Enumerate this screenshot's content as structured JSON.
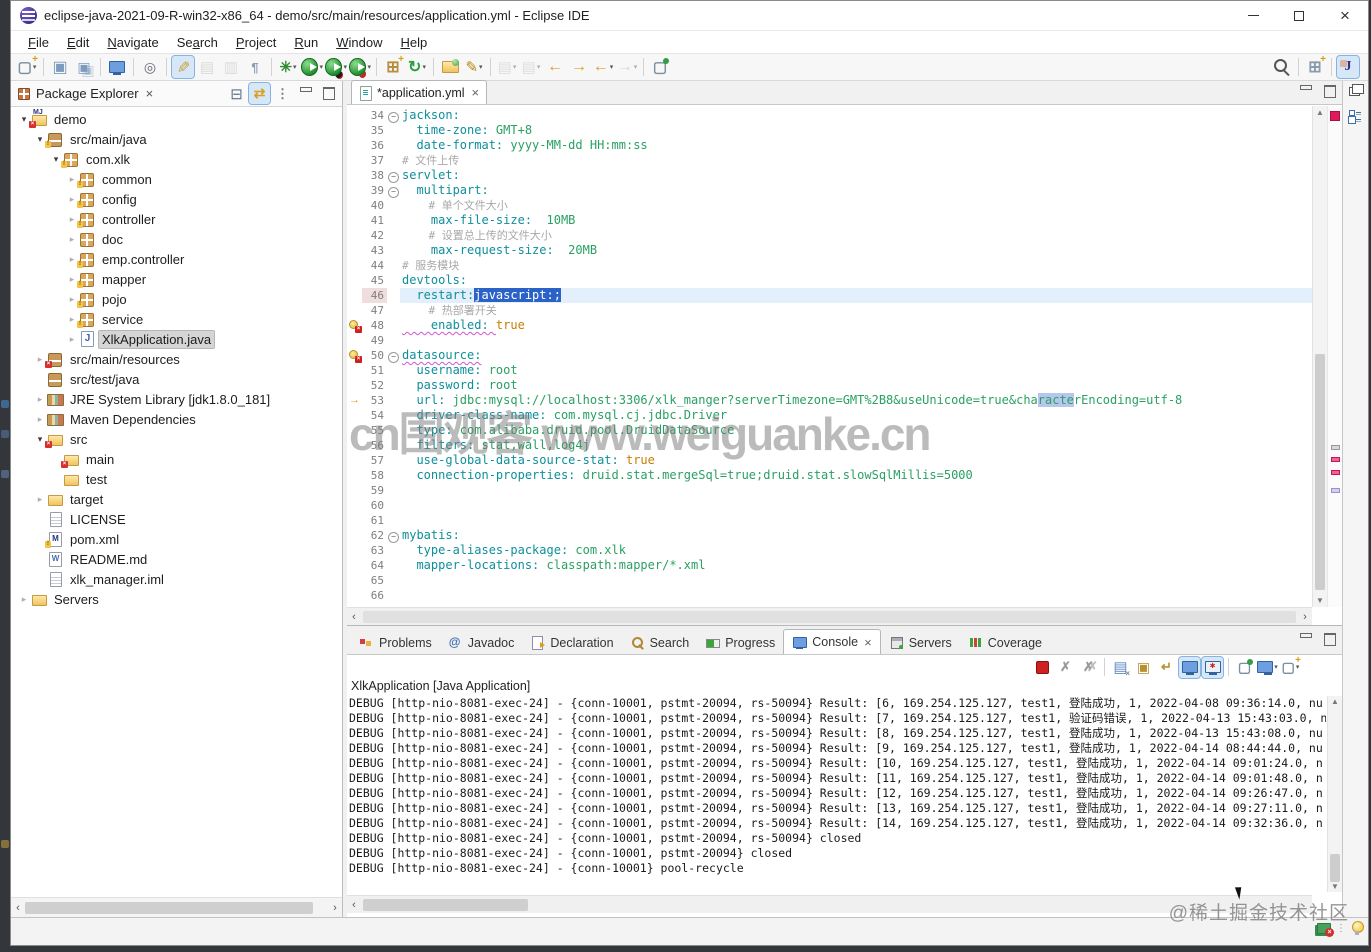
{
  "window": {
    "title": "eclipse-java-2021-09-R-win32-x86_64 - demo/src/main/resources/application.yml - Eclipse IDE"
  },
  "menubar": {
    "items": [
      {
        "label": "File",
        "m": 0
      },
      {
        "label": "Edit",
        "m": 0
      },
      {
        "label": "Navigate",
        "m": 0
      },
      {
        "label": "Search",
        "m": 2
      },
      {
        "label": "Project",
        "m": 0
      },
      {
        "label": "Run",
        "m": 0
      },
      {
        "label": "Window",
        "m": 0
      },
      {
        "label": "Help",
        "m": 0
      }
    ]
  },
  "toolbar": {
    "items": [
      {
        "n": "new-wizard",
        "i": "t-new",
        "dd": true
      },
      {
        "sep": true
      },
      {
        "n": "save",
        "i": "t-save"
      },
      {
        "n": "save-all",
        "i": "t-saveall"
      },
      {
        "sep": true
      },
      {
        "n": "open-console-view",
        "i": "t-monitor"
      },
      {
        "sep": true
      },
      {
        "n": "inspect",
        "i": "t-inspect"
      },
      {
        "sep": true
      },
      {
        "n": "toggle-highlight",
        "i": "t-highlight",
        "active": true
      },
      {
        "n": "copy-qualified-name",
        "i": "t-copyq",
        "dis": true
      },
      {
        "n": "open-element",
        "i": "t-openel",
        "dis": true
      },
      {
        "n": "show-whitespace",
        "i": "t-para"
      },
      {
        "sep": true
      },
      {
        "n": "debug",
        "i": "t-debug",
        "dd": true
      },
      {
        "n": "run",
        "i": "t-run",
        "dd": true
      },
      {
        "n": "coverage",
        "i": "t-coverage",
        "dd": true
      },
      {
        "n": "profile",
        "i": "t-profile",
        "dd": true
      },
      {
        "sep": true
      },
      {
        "n": "new-java-package",
        "i": "t-newpkg"
      },
      {
        "n": "run-external-tools",
        "i": "t-refresh",
        "dd": true
      },
      {
        "sep": true
      },
      {
        "n": "open-resource",
        "i": "t-openres"
      },
      {
        "n": "annotate",
        "i": "t-pen",
        "dd": true
      },
      {
        "sep": true
      },
      {
        "n": "next-annotation",
        "i": "t-nexta",
        "dd": true,
        "dis": true
      },
      {
        "n": "previous-annotation",
        "i": "t-preva",
        "dd": true,
        "dis": true
      },
      {
        "n": "last-edit-location",
        "i": "t-backstar"
      },
      {
        "n": "next-edit-location",
        "i": "t-fwdstar"
      },
      {
        "n": "back-history",
        "i": "t-back",
        "dd": true
      },
      {
        "n": "forward-history",
        "i": "t-fwd",
        "dd": true,
        "dis": true
      },
      {
        "sep": true
      },
      {
        "n": "pin-editor",
        "i": "t-pinedit"
      }
    ],
    "right_items": [
      {
        "n": "search",
        "i": "t-search"
      },
      {
        "sep": true
      },
      {
        "n": "open-perspective",
        "i": "t-persp"
      },
      {
        "sep": true
      },
      {
        "n": "java-perspective",
        "i": "t-javapersp",
        "active": true
      }
    ]
  },
  "package_explorer": {
    "title": "Package Explorer",
    "tools": [
      {
        "n": "collapse-all",
        "i": "p-collapse"
      },
      {
        "n": "link-with-editor",
        "i": "p-link",
        "active": true
      },
      {
        "n": "view-menu",
        "i": "p-menu"
      },
      {
        "n": "minimize-view",
        "i": "p-min"
      },
      {
        "n": "maximize-view",
        "i": "p-max"
      }
    ],
    "tree": [
      {
        "label": "demo",
        "level": 0,
        "arrow": "v",
        "icon": "mvnicon dec-err"
      },
      {
        "label": "src/main/java",
        "level": 1,
        "arrow": "v",
        "icon": "srcicon dec-warn"
      },
      {
        "label": "com.xlk",
        "level": 2,
        "arrow": "v",
        "icon": "pkgicon dec-warn"
      },
      {
        "label": "common",
        "level": 3,
        "arrow": "c",
        "icon": "pkgicon dec-warn"
      },
      {
        "label": "config",
        "level": 3,
        "arrow": "c",
        "icon": "pkgicon dec-warn"
      },
      {
        "label": "controller",
        "level": 3,
        "arrow": "c",
        "icon": "pkgicon dec-warn"
      },
      {
        "label": "doc",
        "level": 3,
        "arrow": "c",
        "icon": "pkgicon"
      },
      {
        "label": "emp.controller",
        "level": 3,
        "arrow": "c",
        "icon": "pkgicon dec-warn"
      },
      {
        "label": "mapper",
        "level": 3,
        "arrow": "c",
        "icon": "pkgicon dec-warn"
      },
      {
        "label": "pojo",
        "level": 3,
        "arrow": "c",
        "icon": "pkgicon dec-warn"
      },
      {
        "label": "service",
        "level": 3,
        "arrow": "c",
        "icon": "pkgicon dec-warn"
      },
      {
        "label": "XlkApplication.java",
        "level": 3,
        "arrow": "c",
        "icon": "javaicon",
        "selected": true
      },
      {
        "label": "src/main/resources",
        "level": 1,
        "arrow": "c",
        "icon": "srcicon dec-err"
      },
      {
        "label": "src/test/java",
        "level": 1,
        "arrow": "",
        "icon": "srcicon"
      },
      {
        "label": "JRE System Library [jdk1.8.0_181]",
        "level": 1,
        "arrow": "c",
        "icon": "libicon"
      },
      {
        "label": "Maven Dependencies",
        "level": 1,
        "arrow": "c",
        "icon": "libicon"
      },
      {
        "label": "src",
        "level": 1,
        "arrow": "v",
        "icon": "foldericon dec-err"
      },
      {
        "label": "main",
        "level": 2,
        "arrow": "",
        "icon": "foldericon dec-err"
      },
      {
        "label": "test",
        "level": 2,
        "arrow": "",
        "icon": "foldericon"
      },
      {
        "label": "target",
        "level": 1,
        "arrow": "c",
        "icon": "foldericon"
      },
      {
        "label": "LICENSE",
        "level": 1,
        "arrow": "",
        "icon": "fileicon"
      },
      {
        "label": "pom.xml",
        "level": 1,
        "arrow": "",
        "icon": "pomicon dec-warn"
      },
      {
        "label": "README.md",
        "level": 1,
        "arrow": "",
        "icon": "mdicon"
      },
      {
        "label": "xlk_manager.iml",
        "level": 1,
        "arrow": "",
        "icon": "fileicon"
      },
      {
        "label": "Servers",
        "level": 0,
        "arrow": "c",
        "icon": "foldericon"
      }
    ]
  },
  "editor": {
    "tab_label": "*application.yml",
    "watermark": "cn围观客 www.weiguanke.cn",
    "lines": [
      {
        "n": 34,
        "fold": true,
        "seg": [
          [
            "k",
            "jackson:"
          ]
        ]
      },
      {
        "n": 35,
        "seg": [
          [
            "k",
            "  time-zone: "
          ],
          [
            "v",
            "GMT+8"
          ]
        ]
      },
      {
        "n": 36,
        "seg": [
          [
            "k",
            "  date-format: "
          ],
          [
            "v",
            "yyyy-MM-dd HH:mm:ss"
          ]
        ]
      },
      {
        "n": 37,
        "seg": [
          [
            "c",
            "# 文件上传"
          ]
        ]
      },
      {
        "n": 38,
        "fold": true,
        "seg": [
          [
            "k",
            "servlet:"
          ]
        ]
      },
      {
        "n": 39,
        "fold": true,
        "seg": [
          [
            "k",
            "  multipart:"
          ]
        ]
      },
      {
        "n": 40,
        "seg": [
          [
            "c",
            "    # 单个文件大小"
          ]
        ]
      },
      {
        "n": 41,
        "seg": [
          [
            "k",
            "    max-file-size:  "
          ],
          [
            "v",
            "10MB"
          ]
        ]
      },
      {
        "n": 42,
        "seg": [
          [
            "c",
            "    # 设置总上传的文件大小"
          ]
        ]
      },
      {
        "n": 43,
        "seg": [
          [
            "k",
            "    max-request-size:  "
          ],
          [
            "v",
            "20MB"
          ]
        ]
      },
      {
        "n": 44,
        "seg": [
          [
            "c",
            "# 服务模块"
          ]
        ]
      },
      {
        "n": 45,
        "seg": [
          [
            "k",
            "devtools:"
          ]
        ]
      },
      {
        "n": 46,
        "cur": true,
        "numhl": true,
        "seg": [
          [
            "k",
            "  restart:"
          ],
          [
            "s",
            "javascript:;"
          ]
        ]
      },
      {
        "n": 47,
        "seg": [
          [
            "c",
            "    # 热部署开关"
          ]
        ]
      },
      {
        "n": 48,
        "err": true,
        "seg": [
          [
            "w",
            "    enabled: "
          ],
          [
            "b",
            "true"
          ]
        ]
      },
      {
        "n": 49,
        "seg": []
      },
      {
        "n": 50,
        "fold": true,
        "err": true,
        "seg": [
          [
            "w",
            "datasource:"
          ]
        ]
      },
      {
        "n": 51,
        "seg": [
          [
            "k",
            "  username: "
          ],
          [
            "v",
            "root"
          ]
        ]
      },
      {
        "n": 52,
        "seg": [
          [
            "k",
            "  password: "
          ],
          [
            "v",
            "root"
          ]
        ]
      },
      {
        "n": 53,
        "arrow": true,
        "seg": [
          [
            "k",
            "  url: "
          ],
          [
            "v",
            "jdbc:mysql://localhost:3306/xlk_manger?serverTimezone=GMT%2B8&useUnicode=true&cha"
          ],
          [
            "o",
            "racte"
          ],
          [
            "v",
            "rEncoding=utf-8"
          ]
        ]
      },
      {
        "n": 54,
        "seg": [
          [
            "k",
            "  driver-class-name: "
          ],
          [
            "v",
            "com.mysql.cj.jdbc.Driver"
          ]
        ]
      },
      {
        "n": 55,
        "seg": [
          [
            "k",
            "  type: "
          ],
          [
            "v",
            "com.alibaba.druid.pool.DruidDataSource"
          ]
        ]
      },
      {
        "n": 56,
        "seg": [
          [
            "k",
            "  filters: "
          ],
          [
            "v",
            "stat,wall,log4j"
          ]
        ]
      },
      {
        "n": 57,
        "seg": [
          [
            "k",
            "  use-global-data-source-stat: "
          ],
          [
            "b",
            "true"
          ]
        ]
      },
      {
        "n": 58,
        "seg": [
          [
            "k",
            "  connection-properties: "
          ],
          [
            "v",
            "druid.stat.mergeSql=true;druid.stat.slowSqlMillis=5000"
          ]
        ]
      },
      {
        "n": 59,
        "seg": []
      },
      {
        "n": 60,
        "seg": []
      },
      {
        "n": 61,
        "seg": []
      },
      {
        "n": 62,
        "fold": true,
        "seg": [
          [
            "k",
            "mybatis:"
          ]
        ]
      },
      {
        "n": 63,
        "seg": [
          [
            "k",
            "  type-aliases-package: "
          ],
          [
            "v",
            "com.xlk"
          ]
        ]
      },
      {
        "n": 64,
        "seg": [
          [
            "k",
            "  mapper-locations: "
          ],
          [
            "v",
            "classpath:mapper/*.xml"
          ]
        ]
      },
      {
        "n": 65,
        "seg": []
      },
      {
        "n": 66,
        "seg": []
      }
    ]
  },
  "console": {
    "tabs": [
      {
        "label": "Problems",
        "icon": "i-problems"
      },
      {
        "label": "Javadoc",
        "icon": "i-javadoc"
      },
      {
        "label": "Declaration",
        "icon": "i-declaration"
      },
      {
        "label": "Search",
        "icon": "i-search"
      },
      {
        "label": "Progress",
        "icon": "i-progress"
      },
      {
        "label": "Console",
        "icon": "i-console",
        "active": true,
        "closable": true
      },
      {
        "label": "Servers",
        "icon": "i-servers"
      },
      {
        "label": "Coverage",
        "icon": "i-coverage"
      }
    ],
    "tools": [
      {
        "n": "terminate",
        "i": "c-term"
      },
      {
        "n": "remove-launch",
        "i": "c-rem"
      },
      {
        "n": "remove-all-terminated",
        "i": "c-remall"
      },
      {
        "sep": true
      },
      {
        "n": "clear-console",
        "i": "c-clear"
      },
      {
        "n": "scroll-lock",
        "i": "c-lock"
      },
      {
        "n": "word-wrap",
        "i": "c-wrap"
      },
      {
        "n": "show-console-on-output",
        "i": "c-showout",
        "active": true
      },
      {
        "n": "show-console-on-error",
        "i": "c-showerr",
        "active": true
      },
      {
        "sep": true
      },
      {
        "n": "pin-console",
        "i": "c-pin"
      },
      {
        "n": "display-selected-console",
        "i": "c-disp",
        "dd": true
      },
      {
        "n": "open-console",
        "i": "c-newcon",
        "dd": true
      }
    ],
    "label": "XlkApplication [Java Application]",
    "lines": [
      "DEBUG [http-nio-8081-exec-24] - {conn-10001, pstmt-20094, rs-50094} Result: [6, 169.254.125.127, test1, 登陆成功, 1, 2022-04-08 09:36:14.0, nu",
      "DEBUG [http-nio-8081-exec-24] - {conn-10001, pstmt-20094, rs-50094} Result: [7, 169.254.125.127, test1, 验证码错误, 1, 2022-04-13 15:43:03.0, n",
      "DEBUG [http-nio-8081-exec-24] - {conn-10001, pstmt-20094, rs-50094} Result: [8, 169.254.125.127, test1, 登陆成功, 1, 2022-04-13 15:43:08.0, nu",
      "DEBUG [http-nio-8081-exec-24] - {conn-10001, pstmt-20094, rs-50094} Result: [9, 169.254.125.127, test1, 登陆成功, 1, 2022-04-14 08:44:44.0, nu",
      "DEBUG [http-nio-8081-exec-24] - {conn-10001, pstmt-20094, rs-50094} Result: [10, 169.254.125.127, test1, 登陆成功, 1, 2022-04-14 09:01:24.0, n",
      "DEBUG [http-nio-8081-exec-24] - {conn-10001, pstmt-20094, rs-50094} Result: [11, 169.254.125.127, test1, 登陆成功, 1, 2022-04-14 09:01:48.0, n",
      "DEBUG [http-nio-8081-exec-24] - {conn-10001, pstmt-20094, rs-50094} Result: [12, 169.254.125.127, test1, 登陆成功, 1, 2022-04-14 09:26:47.0, n",
      "DEBUG [http-nio-8081-exec-24] - {conn-10001, pstmt-20094, rs-50094} Result: [13, 169.254.125.127, test1, 登陆成功, 1, 2022-04-14 09:27:11.0, n",
      "DEBUG [http-nio-8081-exec-24] - {conn-10001, pstmt-20094, rs-50094} Result: [14, 169.254.125.127, test1, 登陆成功, 1, 2022-04-14 09:32:36.0, n",
      "DEBUG [http-nio-8081-exec-24] - {conn-10001, pstmt-20094, rs-50094} closed",
      "DEBUG [http-nio-8081-exec-24] - {conn-10001, pstmt-20094} closed",
      "DEBUG [http-nio-8081-exec-24] - {conn-10001} pool-recycle"
    ]
  },
  "overlays": {
    "community_watermark": "@稀土掘金技术社区"
  }
}
